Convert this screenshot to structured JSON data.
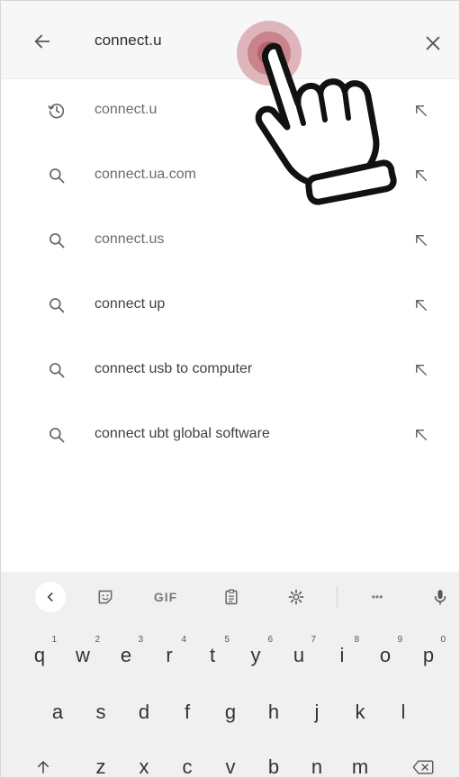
{
  "search": {
    "query": "connect.u"
  },
  "suggestions": [
    {
      "text": "connect.u",
      "icon": "history-icon"
    },
    {
      "text": "connect.ua.com",
      "icon": "search-icon"
    },
    {
      "text": "connect.us",
      "icon": "search-icon"
    },
    {
      "text": "connect up",
      "icon": "search-icon"
    },
    {
      "text": "connect usb to computer",
      "icon": "search-icon"
    },
    {
      "text": "connect ubt global software",
      "icon": "search-icon"
    }
  ],
  "keyboard": {
    "toolbar": {
      "gif_label": "GIF",
      "more_label": "•••"
    },
    "row1": [
      {
        "key": "q",
        "hint": "1"
      },
      {
        "key": "w",
        "hint": "2"
      },
      {
        "key": "e",
        "hint": "3"
      },
      {
        "key": "r",
        "hint": "4"
      },
      {
        "key": "t",
        "hint": "5"
      },
      {
        "key": "y",
        "hint": "6"
      },
      {
        "key": "u",
        "hint": "7"
      },
      {
        "key": "i",
        "hint": "8"
      },
      {
        "key": "o",
        "hint": "9"
      },
      {
        "key": "p",
        "hint": "0"
      }
    ],
    "row2": [
      "a",
      "s",
      "d",
      "f",
      "g",
      "h",
      "j",
      "k",
      "l"
    ],
    "row3": [
      "z",
      "x",
      "c",
      "v",
      "b",
      "n",
      "m"
    ]
  },
  "colors": {
    "tap_indicator": "#c98089",
    "background": "#ffffff",
    "keyboard_bg": "#f0f0f0"
  }
}
